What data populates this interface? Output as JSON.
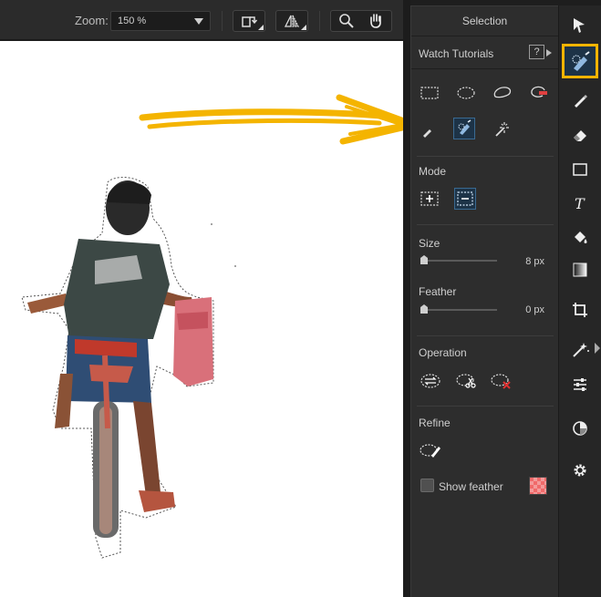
{
  "toolbar": {
    "zoom_label": "Zoom:",
    "zoom_value": "150 %"
  },
  "panel": {
    "title": "Selection",
    "watch_tutorials": "Watch Tutorials",
    "help_glyph": "?",
    "mode_label": "Mode",
    "size_label": "Size",
    "size_value": "8 px",
    "size_level": 0.0,
    "feather_label": "Feather",
    "feather_value": "0 px",
    "feather_level": 0.0,
    "operation_label": "Operation",
    "refine_label": "Refine",
    "show_feather_label": "Show feather",
    "show_feather_checked": false,
    "selection_tools": [
      "rectangle-select-icon",
      "ellipse-select-icon",
      "lasso-icon",
      "subtract-select-icon",
      "pen-select-icon",
      "smart-brush-icon",
      "magic-wand-icon"
    ],
    "active_tool": "smart-brush-icon",
    "active_mode": "subtract-mode-icon"
  },
  "tools": [
    "pointer-icon",
    "smart-brush-icon",
    "brush-icon",
    "eraser-icon",
    "rectangle-icon",
    "text-icon",
    "fill-icon",
    "gradient-icon",
    "crop-icon",
    "magic-icon",
    "adjust-icon",
    "color-icon",
    "settings-icon"
  ],
  "colors": {
    "highlight": "#f4b400",
    "accent": "#3a6a92",
    "panel_bg": "#2d2d2d",
    "feather_swatch": "#f06a6a"
  }
}
